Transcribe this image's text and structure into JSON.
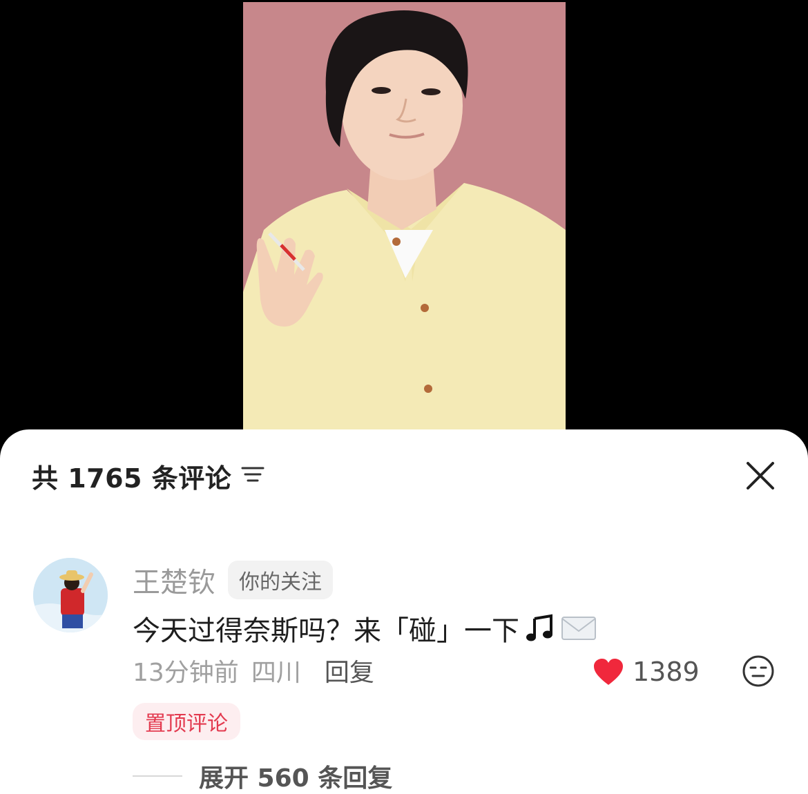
{
  "header": {
    "comment_count_label": "共 1765 条评论",
    "filter_icon": "filter-lines-icon",
    "close_icon": "close-x-icon"
  },
  "comment": {
    "avatar_icon": "avatar-straw-hat-character",
    "username": "王楚钦",
    "follow_badge": "你的关注",
    "text": "今天过得奈斯吗？来「碰」一下",
    "emojis": [
      "music-note-icon",
      "envelope-icon"
    ],
    "time": "13分钟前",
    "location": "四川",
    "reply_label": "回复",
    "like_count": "1389",
    "pinned_label": "置顶评论",
    "expand_replies_label": "展开 560 条回复"
  },
  "colors": {
    "sheet_bg": "#ffffff",
    "like_heart": "#f0283c",
    "pinned_text": "#e33a4f",
    "pinned_bg": "#fdeef0",
    "video_bg": "#c9898d"
  }
}
